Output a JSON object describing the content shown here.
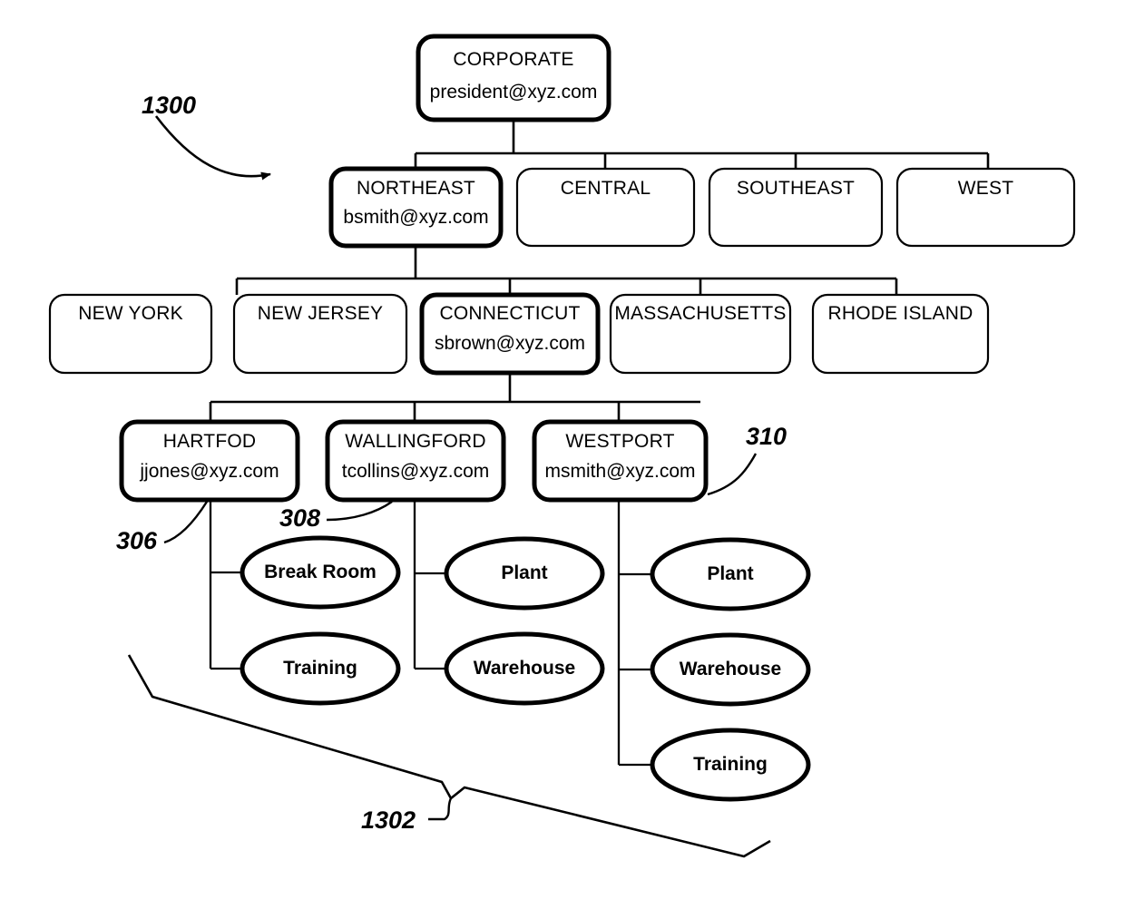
{
  "figure": {
    "type": "organizational-hierarchy-diagram",
    "background_color": "#ffffff",
    "stroke_color": "#000000"
  },
  "nodes": {
    "corporate": {
      "title": "CORPORATE",
      "email": "president@xyz.com"
    },
    "regions": [
      {
        "title": "NORTHEAST",
        "email": "bsmith@xyz.com",
        "emphasis": true
      },
      {
        "title": "CENTRAL",
        "email": "",
        "emphasis": false
      },
      {
        "title": "SOUTHEAST",
        "email": "",
        "emphasis": false
      },
      {
        "title": "WEST",
        "email": "",
        "emphasis": false
      }
    ],
    "states": [
      {
        "title": "NEW YORK",
        "email": "",
        "emphasis": false
      },
      {
        "title": "NEW JERSEY",
        "email": "",
        "emphasis": false
      },
      {
        "title": "CONNECTICUT",
        "email": "sbrown@xyz.com",
        "emphasis": true
      },
      {
        "title": "MASSACHUSETTS",
        "email": "",
        "emphasis": false
      },
      {
        "title": "RHODE ISLAND",
        "email": "",
        "emphasis": false
      }
    ],
    "cities": [
      {
        "title": "HARTFOD",
        "email": "jjones@xyz.com",
        "emphasis": true
      },
      {
        "title": "WALLINGFORD",
        "email": "tcollins@xyz.com",
        "emphasis": true
      },
      {
        "title": "WESTPORT",
        "email": "msmith@xyz.com",
        "emphasis": true
      }
    ],
    "facilities": {
      "hartfod": [
        "Break Room",
        "Training"
      ],
      "wallingford": [
        "Plant",
        "Warehouse"
      ],
      "westport": [
        "Plant",
        "Warehouse",
        "Training"
      ]
    }
  },
  "reference_numerals": {
    "diagram": "1300",
    "hartfod": "306",
    "wallingford": "308",
    "westport": "310",
    "boundary": "1302"
  }
}
